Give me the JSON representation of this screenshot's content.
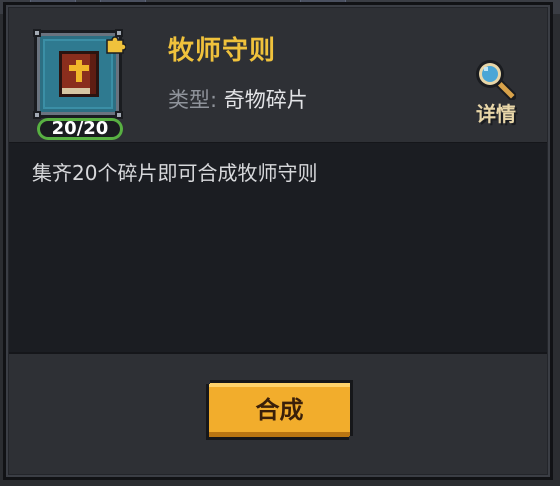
{
  "item": {
    "name": "牧师守则",
    "type_label": "类型:",
    "type_value": "奇物碎片",
    "count": "20/20",
    "icon": "priest-rulebook-icon",
    "fragment_icon": "puzzle-piece-icon"
  },
  "detail_button": {
    "label": "详情",
    "icon": "magnifier-icon"
  },
  "description": "集齐20个碎片即可合成牧师守则",
  "compose_button": {
    "label": "合成"
  },
  "colors": {
    "title": "#f0c23c",
    "button": "#f2ad2c",
    "badge_border": "#58b042",
    "panel": "#23252a"
  }
}
